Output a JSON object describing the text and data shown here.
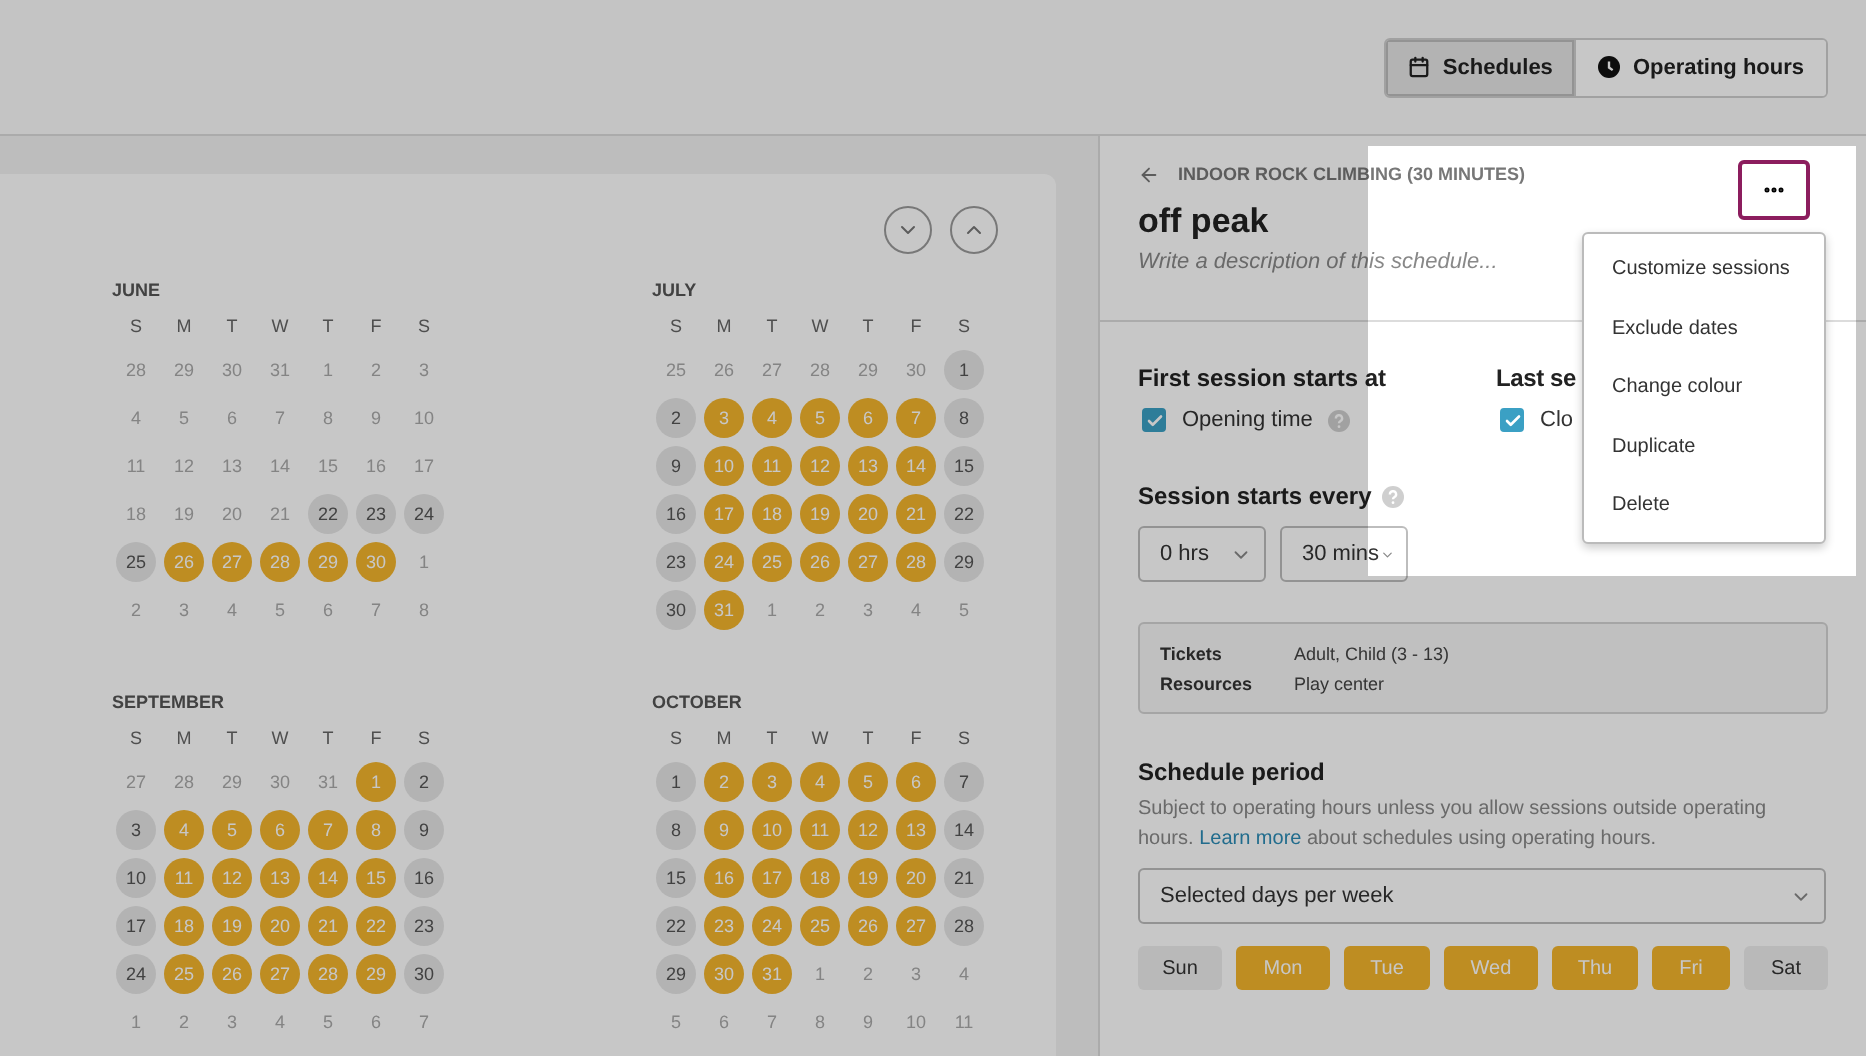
{
  "topbar": {
    "views": [
      {
        "label": "Schedules",
        "selected": true
      },
      {
        "label": "Operating hours",
        "selected": false
      }
    ]
  },
  "calendar": {
    "months": [
      {
        "name": "JUNE",
        "weekdays": [
          "S",
          "M",
          "T",
          "W",
          "T",
          "F",
          "S"
        ],
        "weeks": [
          [
            {
              "n": "28",
              "kind": "muted"
            },
            {
              "n": "29",
              "kind": "muted"
            },
            {
              "n": "30",
              "kind": "muted"
            },
            {
              "n": "31",
              "kind": "muted"
            },
            {
              "n": "1",
              "kind": "muted"
            },
            {
              "n": "2",
              "kind": "muted"
            },
            {
              "n": "3",
              "kind": "muted"
            }
          ],
          [
            {
              "n": "4",
              "kind": "muted"
            },
            {
              "n": "5",
              "kind": "muted"
            },
            {
              "n": "6",
              "kind": "muted"
            },
            {
              "n": "7",
              "kind": "muted"
            },
            {
              "n": "8",
              "kind": "muted"
            },
            {
              "n": "9",
              "kind": "muted"
            },
            {
              "n": "10",
              "kind": "muted"
            }
          ],
          [
            {
              "n": "11",
              "kind": "muted"
            },
            {
              "n": "12",
              "kind": "muted"
            },
            {
              "n": "13",
              "kind": "muted"
            },
            {
              "n": "14",
              "kind": "muted"
            },
            {
              "n": "15",
              "kind": "muted"
            },
            {
              "n": "16",
              "kind": "muted"
            },
            {
              "n": "17",
              "kind": "muted"
            }
          ],
          [
            {
              "n": "18",
              "kind": "muted"
            },
            {
              "n": "19",
              "kind": "muted"
            },
            {
              "n": "20",
              "kind": "muted"
            },
            {
              "n": "21",
              "kind": "muted"
            },
            {
              "n": "22",
              "kind": "closed"
            },
            {
              "n": "23",
              "kind": "closed"
            },
            {
              "n": "24",
              "kind": "closed"
            }
          ],
          [
            {
              "n": "25",
              "kind": "closed"
            },
            {
              "n": "26",
              "kind": "open"
            },
            {
              "n": "27",
              "kind": "open"
            },
            {
              "n": "28",
              "kind": "open"
            },
            {
              "n": "29",
              "kind": "open"
            },
            {
              "n": "30",
              "kind": "open"
            },
            {
              "n": "1",
              "kind": "muted"
            }
          ],
          [
            {
              "n": "2",
              "kind": "muted"
            },
            {
              "n": "3",
              "kind": "muted"
            },
            {
              "n": "4",
              "kind": "muted"
            },
            {
              "n": "5",
              "kind": "muted"
            },
            {
              "n": "6",
              "kind": "muted"
            },
            {
              "n": "7",
              "kind": "muted"
            },
            {
              "n": "8",
              "kind": "muted"
            }
          ]
        ]
      },
      {
        "name": "JULY",
        "weekdays": [
          "S",
          "M",
          "T",
          "W",
          "T",
          "F",
          "S"
        ],
        "weeks": [
          [
            {
              "n": "25",
              "kind": "muted"
            },
            {
              "n": "26",
              "kind": "muted"
            },
            {
              "n": "27",
              "kind": "muted"
            },
            {
              "n": "28",
              "kind": "muted"
            },
            {
              "n": "29",
              "kind": "muted"
            },
            {
              "n": "30",
              "kind": "muted"
            },
            {
              "n": "1",
              "kind": "closed"
            }
          ],
          [
            {
              "n": "2",
              "kind": "closed"
            },
            {
              "n": "3",
              "kind": "open"
            },
            {
              "n": "4",
              "kind": "open"
            },
            {
              "n": "5",
              "kind": "open"
            },
            {
              "n": "6",
              "kind": "open"
            },
            {
              "n": "7",
              "kind": "open"
            },
            {
              "n": "8",
              "kind": "closed"
            }
          ],
          [
            {
              "n": "9",
              "kind": "closed"
            },
            {
              "n": "10",
              "kind": "open"
            },
            {
              "n": "11",
              "kind": "open"
            },
            {
              "n": "12",
              "kind": "open"
            },
            {
              "n": "13",
              "kind": "open"
            },
            {
              "n": "14",
              "kind": "open"
            },
            {
              "n": "15",
              "kind": "closed"
            }
          ],
          [
            {
              "n": "16",
              "kind": "closed"
            },
            {
              "n": "17",
              "kind": "open"
            },
            {
              "n": "18",
              "kind": "open"
            },
            {
              "n": "19",
              "kind": "open"
            },
            {
              "n": "20",
              "kind": "open"
            },
            {
              "n": "21",
              "kind": "open"
            },
            {
              "n": "22",
              "kind": "closed"
            }
          ],
          [
            {
              "n": "23",
              "kind": "closed"
            },
            {
              "n": "24",
              "kind": "open"
            },
            {
              "n": "25",
              "kind": "open"
            },
            {
              "n": "26",
              "kind": "open"
            },
            {
              "n": "27",
              "kind": "open"
            },
            {
              "n": "28",
              "kind": "open"
            },
            {
              "n": "29",
              "kind": "closed"
            }
          ],
          [
            {
              "n": "30",
              "kind": "closed"
            },
            {
              "n": "31",
              "kind": "open"
            },
            {
              "n": "1",
              "kind": "muted"
            },
            {
              "n": "2",
              "kind": "muted"
            },
            {
              "n": "3",
              "kind": "muted"
            },
            {
              "n": "4",
              "kind": "muted"
            },
            {
              "n": "5",
              "kind": "muted"
            }
          ]
        ]
      },
      {
        "name": "SEPTEMBER",
        "weekdays": [
          "S",
          "M",
          "T",
          "W",
          "T",
          "F",
          "S"
        ],
        "weeks": [
          [
            {
              "n": "27",
              "kind": "muted"
            },
            {
              "n": "28",
              "kind": "muted"
            },
            {
              "n": "29",
              "kind": "muted"
            },
            {
              "n": "30",
              "kind": "muted"
            },
            {
              "n": "31",
              "kind": "muted"
            },
            {
              "n": "1",
              "kind": "open"
            },
            {
              "n": "2",
              "kind": "closed"
            }
          ],
          [
            {
              "n": "3",
              "kind": "closed"
            },
            {
              "n": "4",
              "kind": "open"
            },
            {
              "n": "5",
              "kind": "open"
            },
            {
              "n": "6",
              "kind": "open"
            },
            {
              "n": "7",
              "kind": "open"
            },
            {
              "n": "8",
              "kind": "open"
            },
            {
              "n": "9",
              "kind": "closed"
            }
          ],
          [
            {
              "n": "10",
              "kind": "closed"
            },
            {
              "n": "11",
              "kind": "open"
            },
            {
              "n": "12",
              "kind": "open"
            },
            {
              "n": "13",
              "kind": "open"
            },
            {
              "n": "14",
              "kind": "open"
            },
            {
              "n": "15",
              "kind": "open"
            },
            {
              "n": "16",
              "kind": "closed"
            }
          ],
          [
            {
              "n": "17",
              "kind": "closed"
            },
            {
              "n": "18",
              "kind": "open"
            },
            {
              "n": "19",
              "kind": "open"
            },
            {
              "n": "20",
              "kind": "open"
            },
            {
              "n": "21",
              "kind": "open"
            },
            {
              "n": "22",
              "kind": "open"
            },
            {
              "n": "23",
              "kind": "closed"
            }
          ],
          [
            {
              "n": "24",
              "kind": "closed"
            },
            {
              "n": "25",
              "kind": "open"
            },
            {
              "n": "26",
              "kind": "open"
            },
            {
              "n": "27",
              "kind": "open"
            },
            {
              "n": "28",
              "kind": "open"
            },
            {
              "n": "29",
              "kind": "open"
            },
            {
              "n": "30",
              "kind": "closed"
            }
          ],
          [
            {
              "n": "1",
              "kind": "muted"
            },
            {
              "n": "2",
              "kind": "muted"
            },
            {
              "n": "3",
              "kind": "muted"
            },
            {
              "n": "4",
              "kind": "muted"
            },
            {
              "n": "5",
              "kind": "muted"
            },
            {
              "n": "6",
              "kind": "muted"
            },
            {
              "n": "7",
              "kind": "muted"
            }
          ]
        ]
      },
      {
        "name": "OCTOBER",
        "weekdays": [
          "S",
          "M",
          "T",
          "W",
          "T",
          "F",
          "S"
        ],
        "weeks": [
          [
            {
              "n": "1",
              "kind": "closed"
            },
            {
              "n": "2",
              "kind": "open"
            },
            {
              "n": "3",
              "kind": "open"
            },
            {
              "n": "4",
              "kind": "open"
            },
            {
              "n": "5",
              "kind": "open"
            },
            {
              "n": "6",
              "kind": "open"
            },
            {
              "n": "7",
              "kind": "closed"
            }
          ],
          [
            {
              "n": "8",
              "kind": "closed"
            },
            {
              "n": "9",
              "kind": "open"
            },
            {
              "n": "10",
              "kind": "open"
            },
            {
              "n": "11",
              "kind": "open"
            },
            {
              "n": "12",
              "kind": "open"
            },
            {
              "n": "13",
              "kind": "open"
            },
            {
              "n": "14",
              "kind": "closed"
            }
          ],
          [
            {
              "n": "15",
              "kind": "closed"
            },
            {
              "n": "16",
              "kind": "open"
            },
            {
              "n": "17",
              "kind": "open"
            },
            {
              "n": "18",
              "kind": "open"
            },
            {
              "n": "19",
              "kind": "open"
            },
            {
              "n": "20",
              "kind": "open"
            },
            {
              "n": "21",
              "kind": "closed"
            }
          ],
          [
            {
              "n": "22",
              "kind": "closed"
            },
            {
              "n": "23",
              "kind": "open"
            },
            {
              "n": "24",
              "kind": "open"
            },
            {
              "n": "25",
              "kind": "open"
            },
            {
              "n": "26",
              "kind": "open"
            },
            {
              "n": "27",
              "kind": "open"
            },
            {
              "n": "28",
              "kind": "closed"
            }
          ],
          [
            {
              "n": "29",
              "kind": "closed"
            },
            {
              "n": "30",
              "kind": "open"
            },
            {
              "n": "31",
              "kind": "open"
            },
            {
              "n": "1",
              "kind": "muted"
            },
            {
              "n": "2",
              "kind": "muted"
            },
            {
              "n": "3",
              "kind": "muted"
            },
            {
              "n": "4",
              "kind": "muted"
            }
          ],
          [
            {
              "n": "5",
              "kind": "muted"
            },
            {
              "n": "6",
              "kind": "muted"
            },
            {
              "n": "7",
              "kind": "muted"
            },
            {
              "n": "8",
              "kind": "muted"
            },
            {
              "n": "9",
              "kind": "muted"
            },
            {
              "n": "10",
              "kind": "muted"
            },
            {
              "n": "11",
              "kind": "muted"
            }
          ]
        ]
      }
    ]
  },
  "schedule": {
    "breadcrumb": "INDOOR ROCK CLIMBING (30 MINUTES)",
    "title": "off peak",
    "description_placeholder": "Write a description of this schedule...",
    "menu": {
      "open": true,
      "items": [
        "Customize sessions",
        "Exclude dates",
        "Change colour",
        "Duplicate",
        "Delete"
      ]
    },
    "first_session": {
      "heading": "First session starts at",
      "option": {
        "label": "Opening time",
        "checked": true
      }
    },
    "last_session": {
      "heading": "Last se",
      "option": {
        "label": "Clo",
        "checked": true
      }
    },
    "interval": {
      "heading": "Session starts every",
      "hours": "0 hrs",
      "minutes": "30 mins"
    },
    "details": [
      {
        "label": "Tickets",
        "value": "Adult, Child (3 - 13)"
      },
      {
        "label": "Resources",
        "value": "Play center"
      }
    ],
    "period": {
      "heading": "Schedule period",
      "description": "Subject to operating hours unless you allow sessions outside operating hours.",
      "link": "Learn more",
      "description_after": "about schedules using operating hours.",
      "mode": "Selected days per week",
      "days": [
        {
          "label": "Sun",
          "selected": false
        },
        {
          "label": "Mon",
          "selected": true
        },
        {
          "label": "Tue",
          "selected": true
        },
        {
          "label": "Wed",
          "selected": true
        },
        {
          "label": "Thu",
          "selected": true
        },
        {
          "label": "Fri",
          "selected": true
        },
        {
          "label": "Sat",
          "selected": false
        }
      ]
    }
  }
}
